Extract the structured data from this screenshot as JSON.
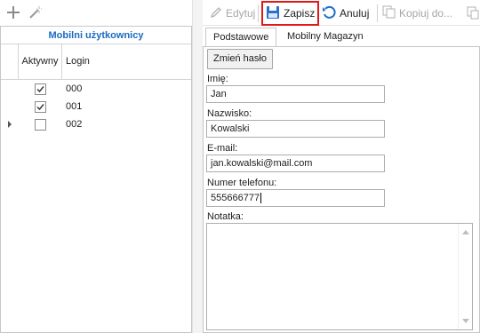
{
  "left_toolbar": {
    "icons": [
      "plus-icon",
      "magic-wand-icon"
    ]
  },
  "grid": {
    "title": "Mobilni użytkownicy",
    "columns": [
      "Aktywny",
      "Login"
    ],
    "rows": [
      {
        "active": true,
        "login": "000",
        "current": false
      },
      {
        "active": true,
        "login": "001",
        "current": false
      },
      {
        "active": false,
        "login": "002",
        "current": true
      }
    ]
  },
  "toolbar": {
    "edit_label": "Edytuj",
    "save_label": "Zapisz",
    "cancel_label": "Anuluj",
    "copy_label": "Kopiuj do..."
  },
  "tabs": [
    {
      "label": "Podstawowe",
      "active": true
    },
    {
      "label": "Mobilny Magazyn",
      "active": false
    }
  ],
  "form": {
    "change_password_label": "Zmień hasło",
    "first_name_label": "Imię:",
    "first_name_value": "Jan",
    "last_name_label": "Nazwisko:",
    "last_name_value": "Kowalski",
    "email_label": "E-mail:",
    "email_value": "jan.kowalski@mail.com",
    "phone_label": "Numer telefonu:",
    "phone_value": "555666777",
    "note_label": "Notatka:",
    "note_value": ""
  },
  "colors": {
    "title_blue": "#1b6ac0",
    "save_icon_blue": "#2a6fd1",
    "highlight_red": "#e01818"
  }
}
